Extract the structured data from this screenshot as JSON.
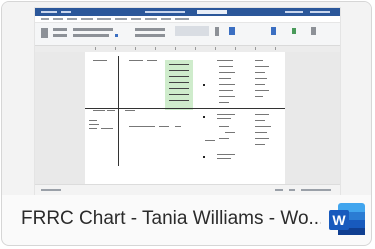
{
  "file": {
    "title": "FRRC Chart - Tania Williams - Wo...",
    "app_icon": "word-icon",
    "app_letter": "W"
  },
  "colors": {
    "word_blue": "#2b579a",
    "word_icon_dark": "#185abd",
    "word_icon_light": "#41a5ee",
    "highlight_green": "#cfeccc"
  }
}
